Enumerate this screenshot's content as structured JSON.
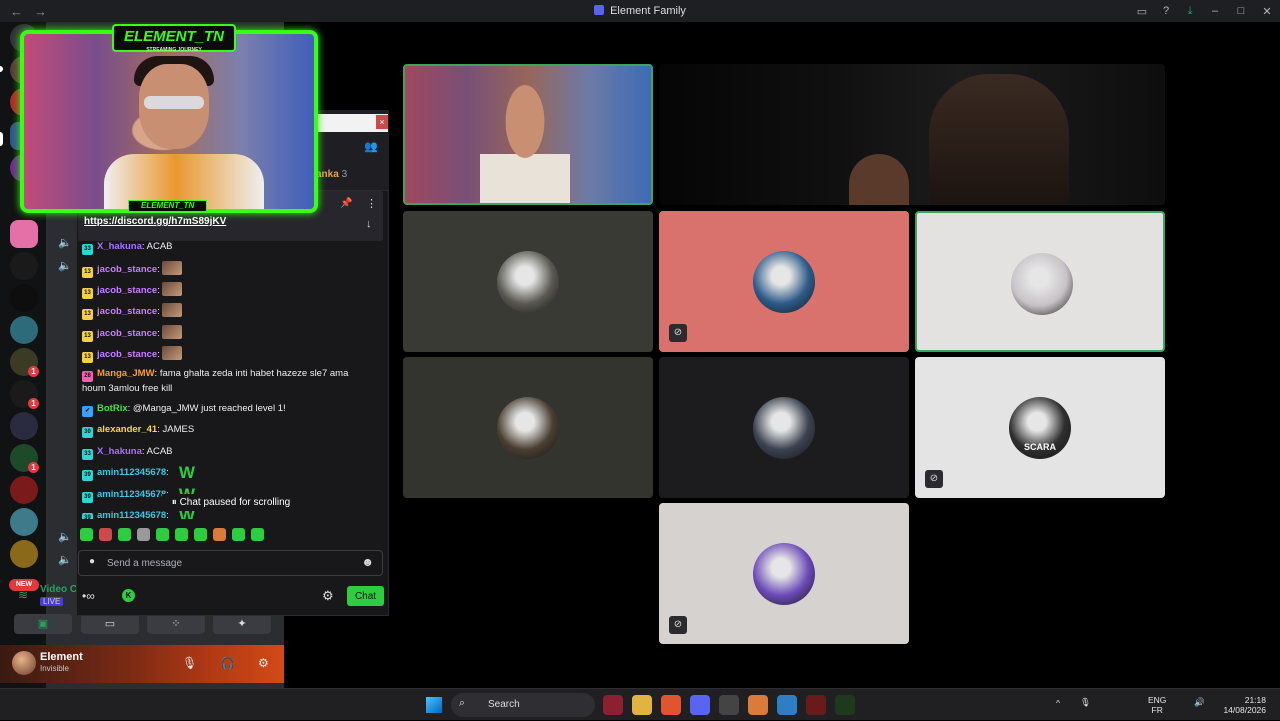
{
  "window": {
    "title": "Element Family",
    "nav_back": "←",
    "nav_forward": "→",
    "controls": [
      "▭",
      "?",
      "⤓",
      "–",
      "□",
      "✕"
    ]
  },
  "cam_overlay": {
    "logo": "ELEMENT_TN",
    "tagline": "STREAMING JOURNEY",
    "bottom_tag": "ELEMENT_TN"
  },
  "chat": {
    "pinned_link": "https://discord.gg/h7mS89jKV",
    "side_user": "anka",
    "side_count": "3",
    "paused": "Chat paused for scrolling",
    "input_placeholder": "Send a message",
    "send_label": "Chat",
    "messages": [
      {
        "badge": "33",
        "badge_color": "#2fd4d4",
        "user": "X_hakuna",
        "user_color": "#a970ff",
        "text": ": ACAB",
        "emote": false,
        "w": false
      },
      {
        "badge": "13",
        "badge_color": "#f5d142",
        "user": "jacob_stance",
        "user_color": "#c77dff",
        "text": ":",
        "emote": true,
        "w": false
      },
      {
        "badge": "13",
        "badge_color": "#f5d142",
        "user": "jacob_stance",
        "user_color": "#c77dff",
        "text": ":",
        "emote": true,
        "w": false
      },
      {
        "badge": "13",
        "badge_color": "#f5d142",
        "user": "jacob_stance",
        "user_color": "#c77dff",
        "text": ":",
        "emote": true,
        "w": false
      },
      {
        "badge": "13",
        "badge_color": "#f5d142",
        "user": "jacob_stance",
        "user_color": "#c77dff",
        "text": ":",
        "emote": true,
        "w": false
      },
      {
        "badge": "13",
        "badge_color": "#f5d142",
        "user": "jacob_stance",
        "user_color": "#c77dff",
        "text": ":",
        "emote": true,
        "w": false
      },
      {
        "badge": "28",
        "badge_color": "#ff5cb1",
        "user": "Manga_JMW",
        "user_color": "#ff9a2e",
        "text": ": fama ghalta zeda inti habet hazeze sle7 ama houm 3amlou free kill",
        "emote": false,
        "w": false
      },
      {
        "badge": "✔",
        "badge_color": "#3aa0ff",
        "user": "BotRix",
        "user_color": "#4ce04c",
        "text": ": @Manga_JMW just reached level 1!",
        "emote": false,
        "w": false
      },
      {
        "badge": "30",
        "badge_color": "#2fd4d4",
        "user": "alexander_41",
        "user_color": "#ffd24d",
        "text": ": JAMES",
        "emote": false,
        "w": false
      },
      {
        "badge": "33",
        "badge_color": "#2fd4d4",
        "user": "X_hakuna",
        "user_color": "#a970ff",
        "text": ": ACAB",
        "emote": false,
        "w": false
      },
      {
        "badge": "39",
        "badge_color": "#2fd4d4",
        "user": "amin112345678",
        "user_color": "#3fc7e0",
        "text": ":",
        "emote": false,
        "w": true
      },
      {
        "badge": "39",
        "badge_color": "#2fd4d4",
        "user": "amin112345678",
        "user_color": "#3fc7e0",
        "text": ":",
        "emote": false,
        "w": true
      },
      {
        "badge": "39",
        "badge_color": "#2fd4d4",
        "user": "amin112345678",
        "user_color": "#3fc7e0",
        "text": ":",
        "emote": false,
        "w": true
      }
    ],
    "w_glyph": "W"
  },
  "voice": {
    "label": "Video C",
    "live": "LIVE",
    "buttons": [
      "▣",
      "▭",
      "⁘",
      "✦"
    ]
  },
  "user": {
    "name": "Element",
    "status": "Invisible"
  },
  "servers": {
    "new_badge": "NEW",
    "badges": [
      "1",
      "1",
      "1"
    ]
  },
  "participants": [
    {
      "kind": "avatar",
      "bg": "#3a3a34",
      "avatar": "#5a5a52",
      "muted": false
    },
    {
      "kind": "avatar",
      "bg": "#d9726d",
      "avatar": "#2e5c8a",
      "muted": true
    },
    {
      "kind": "avatar",
      "bg": "#e4e1e1",
      "avatar": "#c7c2c6",
      "muted": false,
      "active": true
    },
    {
      "kind": "avatar",
      "bg": "#34342f",
      "avatar": "#4a3f33",
      "muted": false
    },
    {
      "kind": "avatar",
      "bg": "#1c1c1e",
      "avatar": "#3b4350",
      "muted": false
    },
    {
      "kind": "avatar",
      "bg": "#e4e4e4",
      "avatar": "#2f2f2f",
      "muted": true,
      "caption": "SCARA"
    },
    {
      "kind": "avatar",
      "bg": "#d5d2cf",
      "avatar": "#6c4bb8",
      "muted": true
    }
  ],
  "taskbar": {
    "search": "Search",
    "lang_top": "ENG",
    "lang_bottom": "FR",
    "time": "21:18",
    "date": "14/08/2026",
    "tray_icons": [
      "^",
      "🎙",
      "🔊"
    ]
  }
}
